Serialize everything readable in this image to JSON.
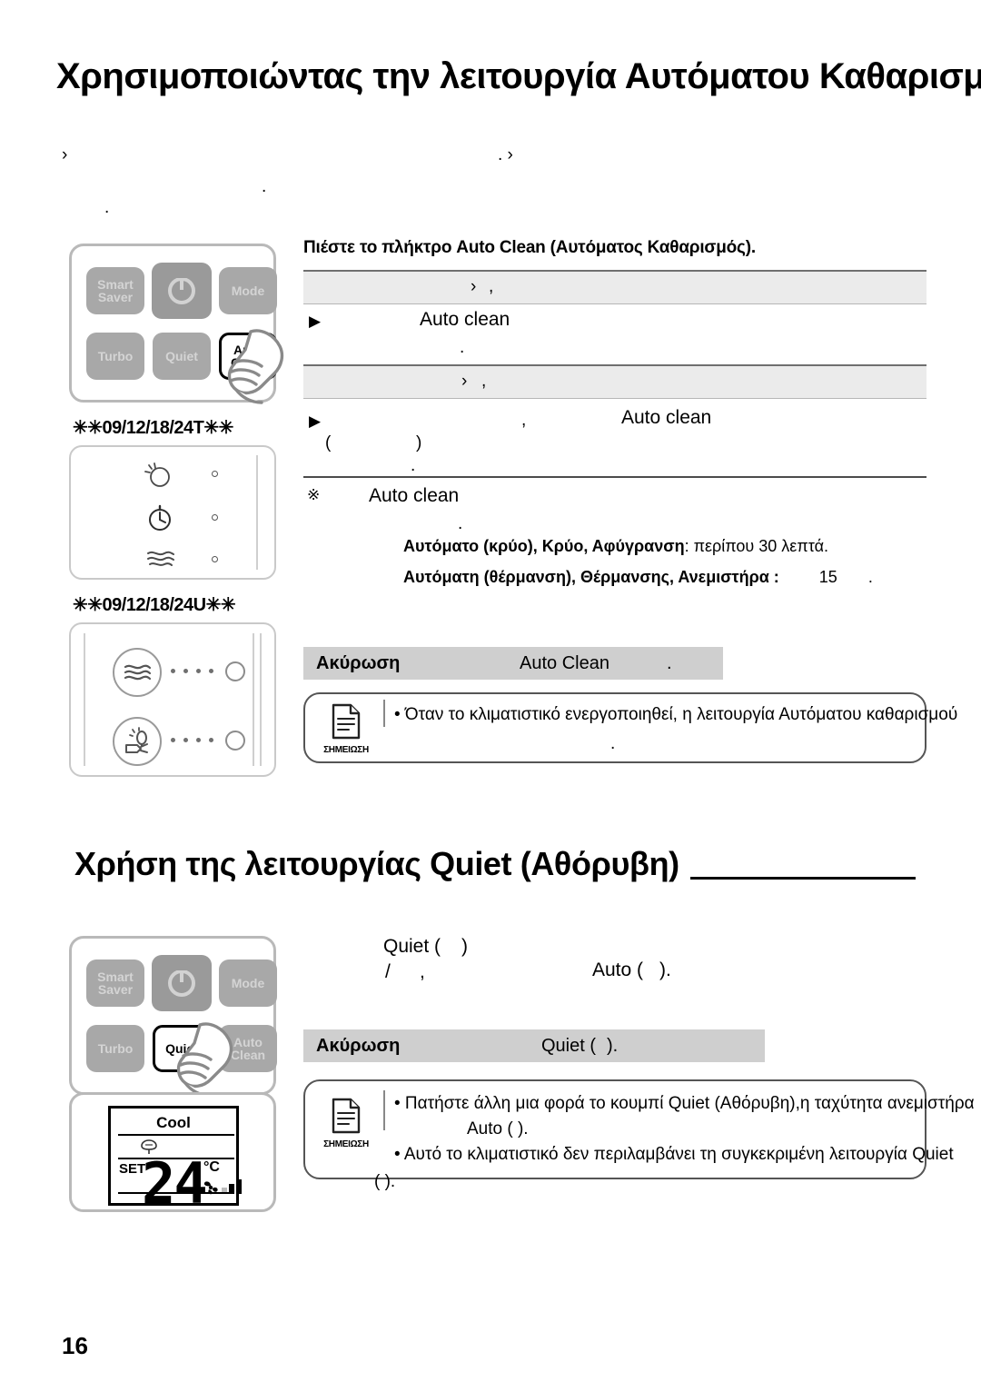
{
  "document": {
    "page_number": "16"
  },
  "section_auto_clean": {
    "title": "Χρησιμοποιώντας την λειτουργία Αυτόματου Καθαρισμού",
    "intro_fragments": [
      "›",
      ". ›",
      ".",
      "."
    ],
    "step_heading": "Πιέστε το πλήκτρο Auto Clean (Αυτόματος Καθαρισμός).",
    "rows": [
      {
        "type": "gray",
        "fragments": [
          "›",
          ","
        ]
      },
      {
        "type": "body",
        "marker": "▶",
        "text": "Auto clean",
        "trailing_fragment": "."
      },
      {
        "type": "gray",
        "fragments": [
          "›",
          ","
        ]
      },
      {
        "type": "body",
        "marker": "▶",
        "lead_fragment": ",",
        "text": "Auto clean",
        "extra_fragments": [
          "(",
          ")",
          "."
        ]
      },
      {
        "type": "note",
        "marker": "※",
        "text": "Auto clean",
        "trailing_fragment": "."
      }
    ],
    "duration_lines": [
      {
        "bold": "Αυτόματο (κρύο), Κρύο, Αφύγρανση",
        "rest": ": περίπου 30 λεπτά."
      },
      {
        "bold": "Αυτόματη (θέρμανση), Θέρμανσης, Ανεμιστήρα :",
        "rest": "15",
        "tail": "."
      }
    ],
    "cancel": {
      "label": "Ακύρωση",
      "value": "Auto Clean",
      "tail": "."
    },
    "note": {
      "icon_label": "ΣΗΜΕΙΩΣΗ",
      "lines": [
        "• Όταν το κλιματιστικό ενεργοποιηθεί, η λειτουργία Αυτόματου καθαρισμού",
        "."
      ]
    },
    "remote": {
      "buttons": [
        {
          "name": "smart-saver",
          "line1": "Smart",
          "line2": "Saver",
          "state": "dim"
        },
        {
          "name": "power",
          "line1": "",
          "line2": "",
          "state": "power"
        },
        {
          "name": "mode",
          "line1": "Mode",
          "line2": "",
          "state": "dim"
        },
        {
          "name": "turbo",
          "line1": "Turbo",
          "line2": "",
          "state": "dim"
        },
        {
          "name": "quiet",
          "line1": "Quiet",
          "line2": "",
          "state": "dim"
        },
        {
          "name": "auto-clean",
          "line1": "Auto",
          "line2": "Clean",
          "state": "highlight"
        }
      ]
    },
    "panels": [
      {
        "label": "✳✳09/12/18/24T✳✳",
        "icons": [
          "sun-moon-icon",
          "timer-icon",
          "wave-icon"
        ]
      },
      {
        "label": "✳✳09/12/18/24U✳✳",
        "icons": [
          "wave-icon",
          "plug-energy-icon"
        ]
      }
    ]
  },
  "section_quiet": {
    "title": "Χρήση της λειτουργίας Quiet (Αθόρυβη)",
    "body_fragments": [
      {
        "text": "Quiet ("
      },
      {
        "text": ")"
      },
      {
        "text": "/"
      },
      {
        "text": ","
      },
      {
        "text": "Auto ("
      },
      {
        "text": ")."
      }
    ],
    "cancel": {
      "label": "Ακύρωση",
      "value": "Quiet (",
      "tail": ")."
    },
    "note": {
      "icon_label": "ΣΗΜΕΙΩΣΗ",
      "lines": [
        "• Πατήστε άλλη μια φορά το κουμπί Quiet (Αθόρυβη),η ταχύτητα ανεμιστήρα",
        "Auto (         ).",
        "• Αυτό το κλιματιστικό δεν περιλαμβάνει τη συγκεκριμένη λειτουργία Quiet",
        "(      )."
      ]
    },
    "remote": {
      "buttons": [
        {
          "name": "smart-saver",
          "line1": "Smart",
          "line2": "Saver",
          "state": "dim"
        },
        {
          "name": "power",
          "line1": "",
          "line2": "",
          "state": "power"
        },
        {
          "name": "mode",
          "line1": "Mode",
          "line2": "",
          "state": "dim"
        },
        {
          "name": "turbo",
          "line1": "Turbo",
          "line2": "",
          "state": "dim"
        },
        {
          "name": "quiet",
          "line1": "Quiet",
          "line2": "",
          "state": "highlight"
        },
        {
          "name": "auto-clean",
          "line1": "Auto",
          "line2": "Clean",
          "state": "dim"
        }
      ]
    },
    "lcd": {
      "mode": "Cool",
      "set_label": "SET",
      "temperature": "24",
      "unit": "°C",
      "fan_icon": "fan-icon",
      "quiet_icon": "quiet-leaf-icon"
    }
  }
}
